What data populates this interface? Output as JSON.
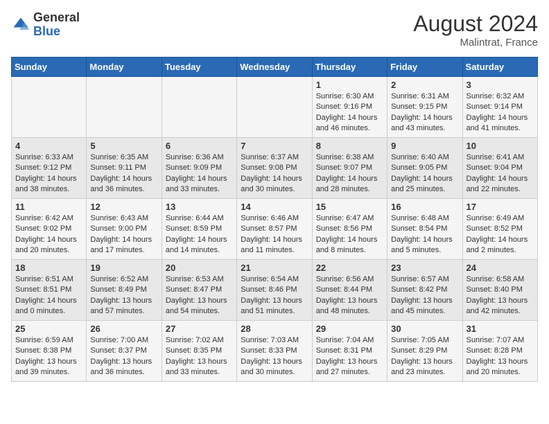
{
  "logo": {
    "general": "General",
    "blue": "Blue"
  },
  "title": {
    "month_year": "August 2024",
    "location": "Malintrat, France"
  },
  "days_of_week": [
    "Sunday",
    "Monday",
    "Tuesday",
    "Wednesday",
    "Thursday",
    "Friday",
    "Saturday"
  ],
  "weeks": [
    [
      {
        "day": "",
        "content": ""
      },
      {
        "day": "",
        "content": ""
      },
      {
        "day": "",
        "content": ""
      },
      {
        "day": "",
        "content": ""
      },
      {
        "day": "1",
        "content": "Sunrise: 6:30 AM\nSunset: 9:16 PM\nDaylight: 14 hours\nand 46 minutes."
      },
      {
        "day": "2",
        "content": "Sunrise: 6:31 AM\nSunset: 9:15 PM\nDaylight: 14 hours\nand 43 minutes."
      },
      {
        "day": "3",
        "content": "Sunrise: 6:32 AM\nSunset: 9:14 PM\nDaylight: 14 hours\nand 41 minutes."
      }
    ],
    [
      {
        "day": "4",
        "content": "Sunrise: 6:33 AM\nSunset: 9:12 PM\nDaylight: 14 hours\nand 38 minutes."
      },
      {
        "day": "5",
        "content": "Sunrise: 6:35 AM\nSunset: 9:11 PM\nDaylight: 14 hours\nand 36 minutes."
      },
      {
        "day": "6",
        "content": "Sunrise: 6:36 AM\nSunset: 9:09 PM\nDaylight: 14 hours\nand 33 minutes."
      },
      {
        "day": "7",
        "content": "Sunrise: 6:37 AM\nSunset: 9:08 PM\nDaylight: 14 hours\nand 30 minutes."
      },
      {
        "day": "8",
        "content": "Sunrise: 6:38 AM\nSunset: 9:07 PM\nDaylight: 14 hours\nand 28 minutes."
      },
      {
        "day": "9",
        "content": "Sunrise: 6:40 AM\nSunset: 9:05 PM\nDaylight: 14 hours\nand 25 minutes."
      },
      {
        "day": "10",
        "content": "Sunrise: 6:41 AM\nSunset: 9:04 PM\nDaylight: 14 hours\nand 22 minutes."
      }
    ],
    [
      {
        "day": "11",
        "content": "Sunrise: 6:42 AM\nSunset: 9:02 PM\nDaylight: 14 hours\nand 20 minutes."
      },
      {
        "day": "12",
        "content": "Sunrise: 6:43 AM\nSunset: 9:00 PM\nDaylight: 14 hours\nand 17 minutes."
      },
      {
        "day": "13",
        "content": "Sunrise: 6:44 AM\nSunset: 8:59 PM\nDaylight: 14 hours\nand 14 minutes."
      },
      {
        "day": "14",
        "content": "Sunrise: 6:46 AM\nSunset: 8:57 PM\nDaylight: 14 hours\nand 11 minutes."
      },
      {
        "day": "15",
        "content": "Sunrise: 6:47 AM\nSunset: 8:56 PM\nDaylight: 14 hours\nand 8 minutes."
      },
      {
        "day": "16",
        "content": "Sunrise: 6:48 AM\nSunset: 8:54 PM\nDaylight: 14 hours\nand 5 minutes."
      },
      {
        "day": "17",
        "content": "Sunrise: 6:49 AM\nSunset: 8:52 PM\nDaylight: 14 hours\nand 2 minutes."
      }
    ],
    [
      {
        "day": "18",
        "content": "Sunrise: 6:51 AM\nSunset: 8:51 PM\nDaylight: 14 hours\nand 0 minutes."
      },
      {
        "day": "19",
        "content": "Sunrise: 6:52 AM\nSunset: 8:49 PM\nDaylight: 13 hours\nand 57 minutes."
      },
      {
        "day": "20",
        "content": "Sunrise: 6:53 AM\nSunset: 8:47 PM\nDaylight: 13 hours\nand 54 minutes."
      },
      {
        "day": "21",
        "content": "Sunrise: 6:54 AM\nSunset: 8:46 PM\nDaylight: 13 hours\nand 51 minutes."
      },
      {
        "day": "22",
        "content": "Sunrise: 6:56 AM\nSunset: 8:44 PM\nDaylight: 13 hours\nand 48 minutes."
      },
      {
        "day": "23",
        "content": "Sunrise: 6:57 AM\nSunset: 8:42 PM\nDaylight: 13 hours\nand 45 minutes."
      },
      {
        "day": "24",
        "content": "Sunrise: 6:58 AM\nSunset: 8:40 PM\nDaylight: 13 hours\nand 42 minutes."
      }
    ],
    [
      {
        "day": "25",
        "content": "Sunrise: 6:59 AM\nSunset: 8:38 PM\nDaylight: 13 hours\nand 39 minutes."
      },
      {
        "day": "26",
        "content": "Sunrise: 7:00 AM\nSunset: 8:37 PM\nDaylight: 13 hours\nand 36 minutes."
      },
      {
        "day": "27",
        "content": "Sunrise: 7:02 AM\nSunset: 8:35 PM\nDaylight: 13 hours\nand 33 minutes."
      },
      {
        "day": "28",
        "content": "Sunrise: 7:03 AM\nSunset: 8:33 PM\nDaylight: 13 hours\nand 30 minutes."
      },
      {
        "day": "29",
        "content": "Sunrise: 7:04 AM\nSunset: 8:31 PM\nDaylight: 13 hours\nand 27 minutes."
      },
      {
        "day": "30",
        "content": "Sunrise: 7:05 AM\nSunset: 8:29 PM\nDaylight: 13 hours\nand 23 minutes."
      },
      {
        "day": "31",
        "content": "Sunrise: 7:07 AM\nSunset: 8:28 PM\nDaylight: 13 hours\nand 20 minutes."
      }
    ]
  ]
}
